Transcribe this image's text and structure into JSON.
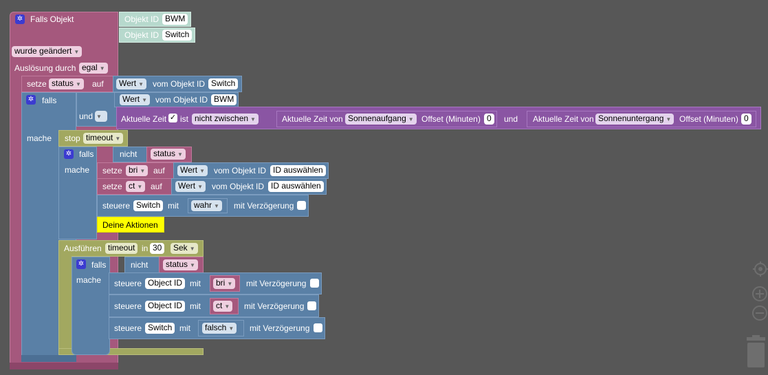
{
  "event": {
    "title": "Falls Objekt",
    "oid1_label": "Objekt ID",
    "oid1_value": "BWM",
    "oid2_label": "Objekt ID",
    "oid2_value": "Switch",
    "changed": "wurde geändert",
    "trigger_label": "Auslösung durch",
    "trigger_value": "egal"
  },
  "set_status": {
    "setze": "setze",
    "var": "status",
    "auf": "auf",
    "wert": "Wert",
    "vom": "vom Objekt ID",
    "oid": "Switch"
  },
  "if1": {
    "falls": "falls",
    "mache": "mache",
    "wert": "Wert",
    "vom": "vom Objekt ID",
    "oid": "BWM",
    "und": "und",
    "time_label": "Aktuelle Zeit",
    "ist": "ist",
    "op": "nicht zwischen",
    "from_label": "Aktuelle Zeit von",
    "from_value": "Sonnenaufgang",
    "offset_label": "Offset (Minuten)",
    "offset_from": "0",
    "und2": "und",
    "to_label": "Aktuelle Zeit von",
    "to_value": "Sonnenuntergang",
    "offset_label2": "Offset (Minuten)",
    "offset_to": "0"
  },
  "stop": {
    "label": "stop",
    "value": "timeout"
  },
  "if2": {
    "falls": "falls",
    "nicht": "nicht",
    "var": "status",
    "mache": "mache",
    "set_bri": {
      "setze": "setze",
      "var": "bri",
      "auf": "auf",
      "wert": "Wert",
      "vom": "vom Objekt ID",
      "oid": "ID auswählen"
    },
    "set_ct": {
      "setze": "setze",
      "var": "ct",
      "auf": "auf",
      "wert": "Wert",
      "vom": "vom Objekt ID",
      "oid": "ID auswählen"
    },
    "control": {
      "steuere": "steuere",
      "oid": "Switch",
      "mit": "mit",
      "value": "wahr",
      "delay": "mit Verzögerung"
    },
    "actions": "Deine Aktionen"
  },
  "timeout": {
    "label": "Ausführen",
    "name": "timeout",
    "in": "in",
    "value": "30",
    "unit": "Sek",
    "falls": "falls",
    "nicht": "nicht",
    "var": "status",
    "mache": "mache",
    "c1": {
      "steuere": "steuere",
      "oid": "Object ID",
      "mit": "mit",
      "var": "bri",
      "delay": "mit Verzögerung"
    },
    "c2": {
      "steuere": "steuere",
      "oid": "Object ID",
      "mit": "mit",
      "var": "ct",
      "delay": "mit Verzögerung"
    },
    "c3": {
      "steuere": "steuere",
      "oid": "Switch",
      "mit": "mit",
      "value": "falsch",
      "delay": "mit Verzögerung"
    }
  },
  "icons": {
    "gear": "gear-icon",
    "target": "target-icon",
    "zoom_in": "zoom-in-icon",
    "zoom_out": "zoom-out-icon",
    "trash": "trash-icon"
  }
}
